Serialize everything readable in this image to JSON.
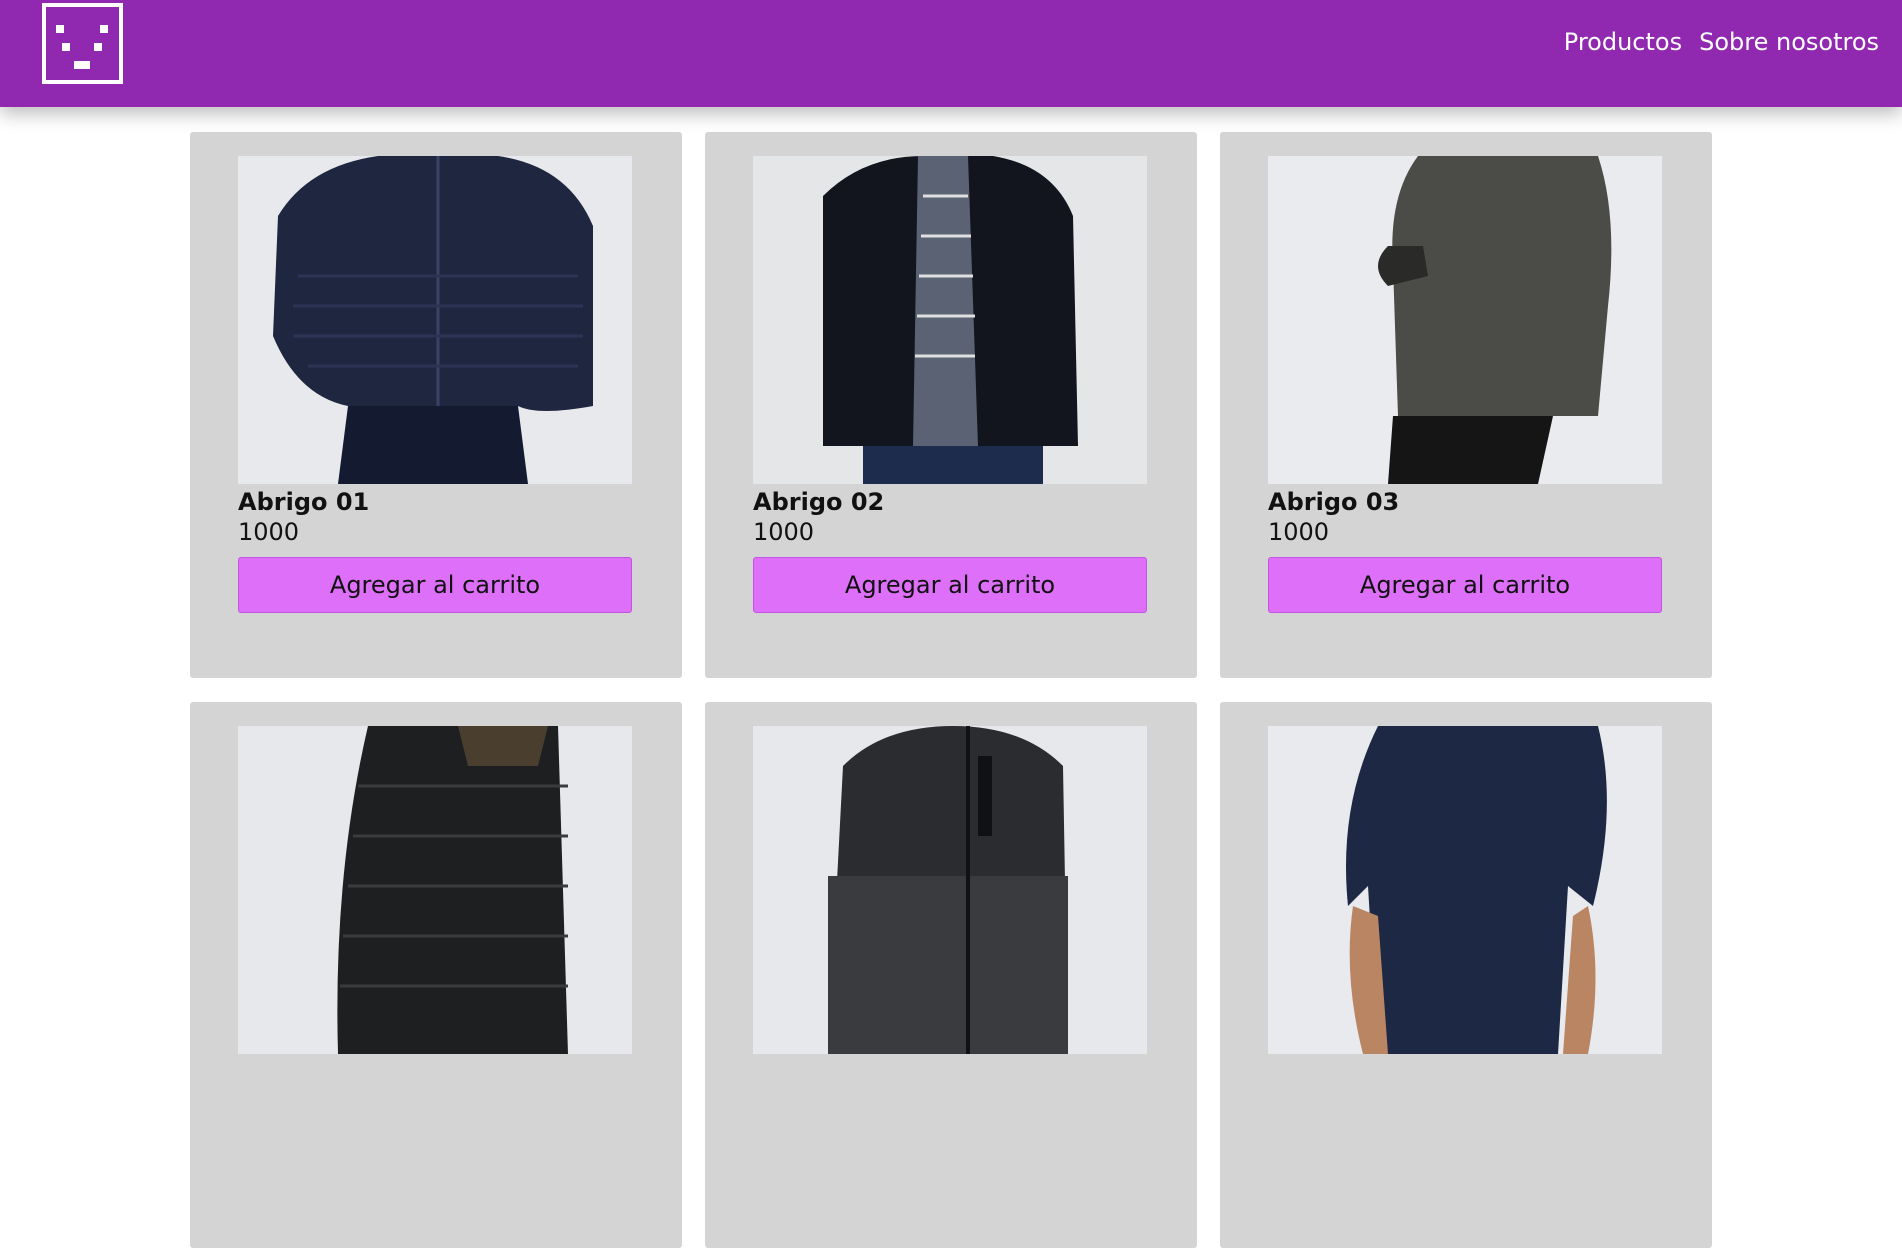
{
  "header": {
    "logo_icon": "pixel-face-icon",
    "nav": [
      {
        "label": "Productos"
      },
      {
        "label": "Sobre nosotros"
      }
    ],
    "background_color": "#9129b0"
  },
  "products": [
    {
      "name": "Abrigo 01",
      "price": "1000",
      "button_label": "Agregar al carrito",
      "garment_color": "#1f2640"
    },
    {
      "name": "Abrigo 02",
      "price": "1000",
      "button_label": "Agregar al carrito",
      "garment_color": "#12151d"
    },
    {
      "name": "Abrigo 03",
      "price": "1000",
      "button_label": "Agregar al carrito",
      "garment_color": "#4b4c47"
    },
    {
      "name": "",
      "price": "",
      "button_label": "",
      "garment_color": "#1e1f20"
    },
    {
      "name": "",
      "price": "",
      "button_label": "",
      "garment_color": "#2b2c30"
    },
    {
      "name": "",
      "price": "",
      "button_label": "",
      "garment_color": "#1c2844"
    }
  ],
  "colors": {
    "accent_button": "#dd6ff8",
    "card_background": "#d4d4d4"
  }
}
